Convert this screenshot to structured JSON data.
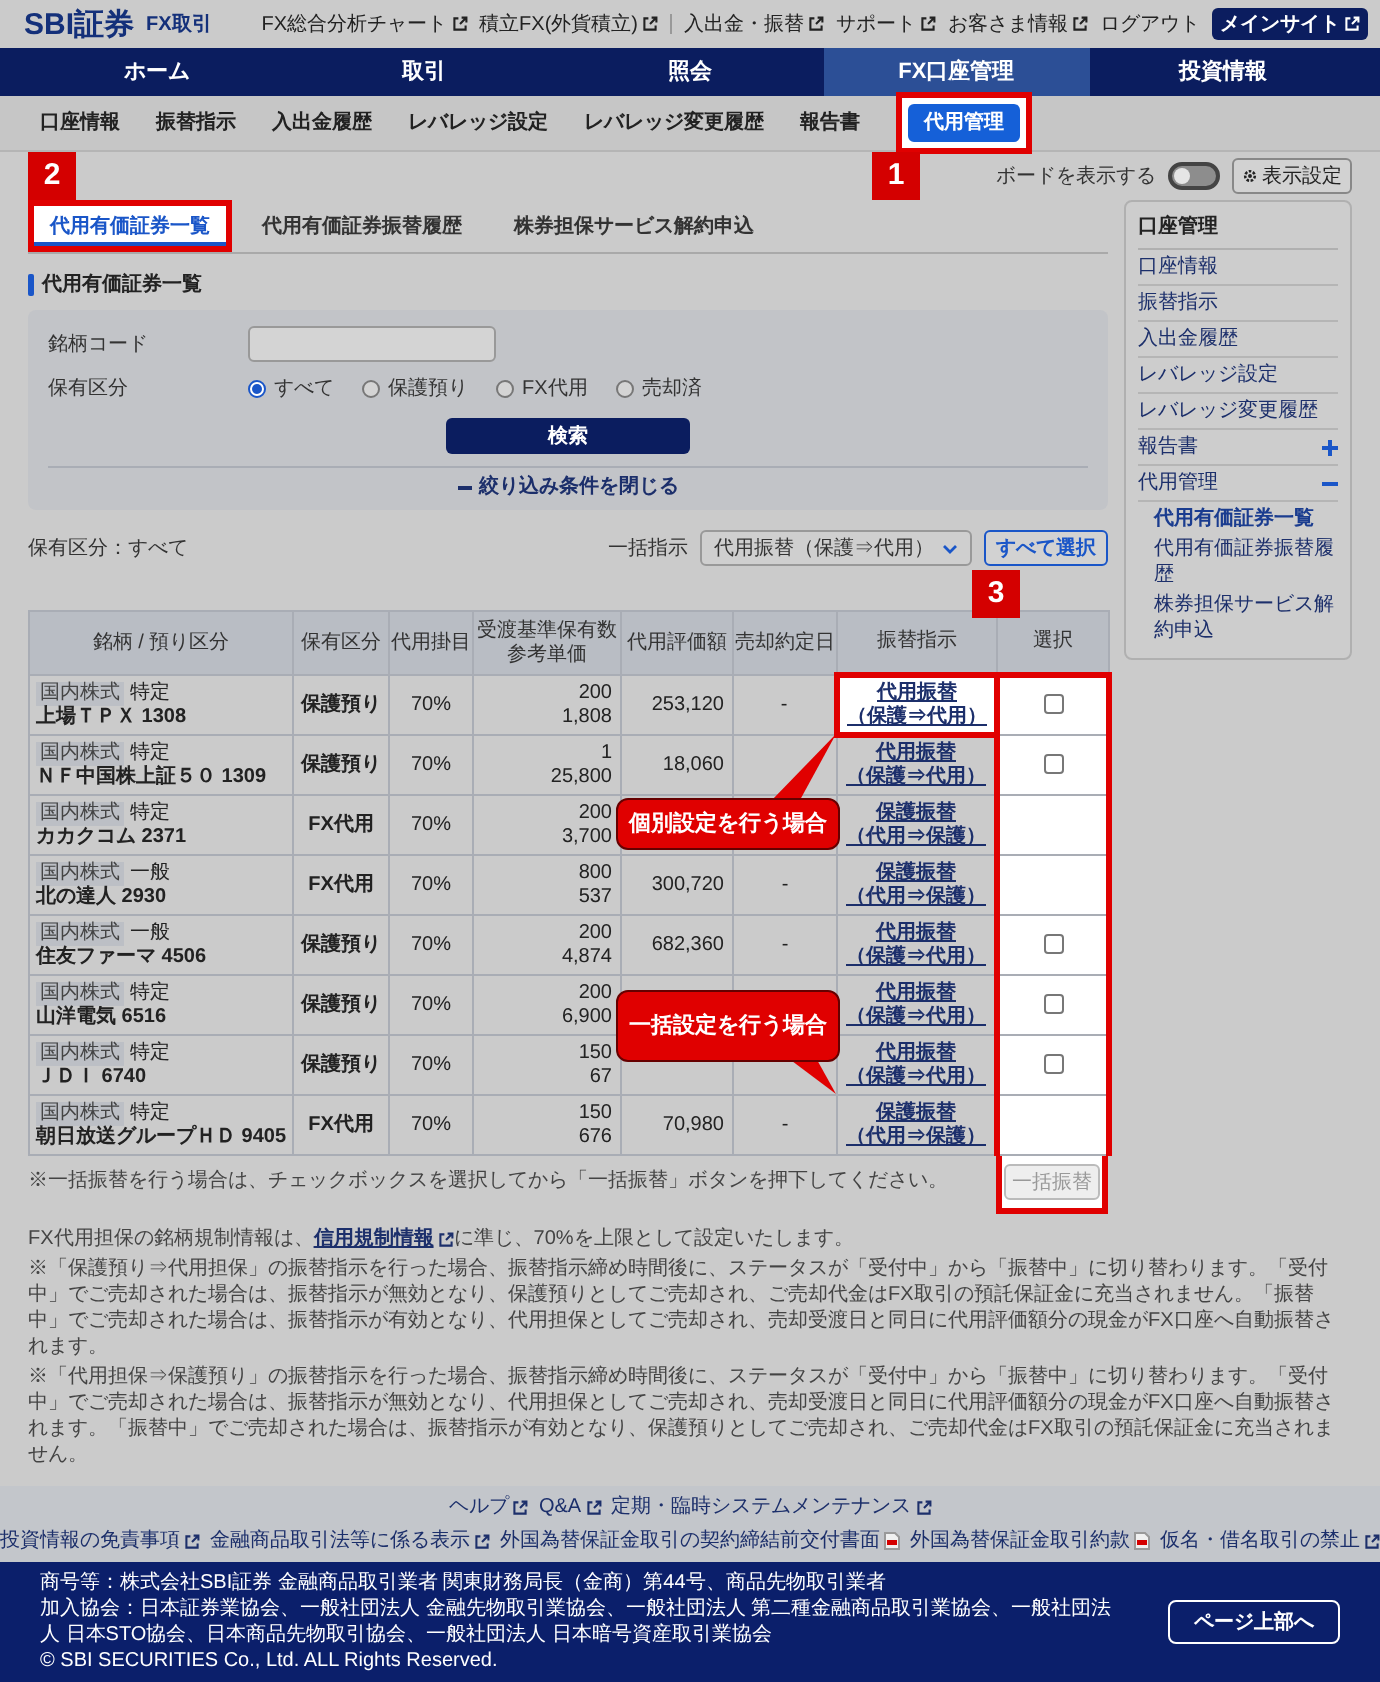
{
  "header": {
    "logo": "SBI証券",
    "product": "FX取引",
    "links": [
      {
        "label": "FX総合分析チャート",
        "kind": "external"
      },
      {
        "label": "積立FX(外貨積立)",
        "kind": "external"
      },
      {
        "label": "入出金・振替",
        "kind": "external"
      },
      {
        "label": "サポート",
        "kind": "external"
      },
      {
        "label": "お客さま情報",
        "kind": "external"
      },
      {
        "label": "ログアウト",
        "kind": "plain"
      }
    ],
    "main_site_button": "メインサイト"
  },
  "nav": [
    {
      "label": "ホーム",
      "selected": false
    },
    {
      "label": "取引",
      "selected": false
    },
    {
      "label": "照会",
      "selected": false
    },
    {
      "label": "FX口座管理",
      "selected": true
    },
    {
      "label": "投資情報",
      "selected": false
    }
  ],
  "subnav": [
    {
      "label": "口座情報",
      "selected": false
    },
    {
      "label": "振替指示",
      "selected": false
    },
    {
      "label": "入出金履歴",
      "selected": false
    },
    {
      "label": "レバレッジ設定",
      "selected": false
    },
    {
      "label": "レバレッジ変更履歴",
      "selected": false
    },
    {
      "label": "報告書",
      "selected": false
    },
    {
      "label": "代用管理",
      "selected": true
    }
  ],
  "board_toggle": {
    "label": "ボードを表示する",
    "on": false
  },
  "display_settings_button": "表示設定",
  "tabs": [
    {
      "label": "代用有価証券一覧",
      "selected": true
    },
    {
      "label": "代用有価証券振替履歴",
      "selected": false
    },
    {
      "label": "株券担保サービス解約申込",
      "selected": false
    }
  ],
  "section_title": "代用有価証券一覧",
  "filter": {
    "code_label": "銘柄コード",
    "holding_label": "保有区分",
    "options": [
      {
        "label": "すべて",
        "selected": true
      },
      {
        "label": "保護預り",
        "selected": false
      },
      {
        "label": "FX代用",
        "selected": false
      },
      {
        "label": "売却済",
        "selected": false
      }
    ],
    "search_button": "検索",
    "collapse_link": "絞り込み条件を閉じる"
  },
  "results": {
    "summary": "保有区分：すべて",
    "bulk_label": "一括指示",
    "bulk_select": "代用振替（保護⇒代用）",
    "select_all_button": "すべて選択",
    "columns": [
      {
        "label": "銘柄 / 預り区分"
      },
      {
        "label": "保有区分"
      },
      {
        "label": "代用掛目"
      },
      {
        "label": "受渡基準保有数",
        "sublabel": "参考単価"
      },
      {
        "label": "代用評価額"
      },
      {
        "label": "売却約定日"
      },
      {
        "label": "振替指示"
      },
      {
        "label": "選択"
      }
    ],
    "rows": [
      {
        "category": "国内株式",
        "account": "特定",
        "name": "上場ＴＰＸ 1308",
        "holding": "保護預り",
        "ratio": "70%",
        "quantity": "200",
        "unit_price": "1,808",
        "valuation": "253,120",
        "sale_date": "-",
        "action": {
          "label": "代用振替",
          "direction": "（保護⇒代用）",
          "highlighted": true
        },
        "selectable": true,
        "checked": false
      },
      {
        "category": "国内株式",
        "account": "特定",
        "name": "ＮＦ中国株上証５０ 1309",
        "holding": "保護預り",
        "ratio": "70%",
        "quantity": "1",
        "unit_price": "25,800",
        "valuation": "18,060",
        "action": {
          "label": "代用振替",
          "direction": "（保護⇒代用）",
          "highlighted": false
        },
        "selectable": true,
        "checked": false
      },
      {
        "category": "国内株式",
        "account": "特定",
        "name": "カカクコム 2371",
        "holding": "FX代用",
        "ratio": "70%",
        "quantity": "200",
        "unit_price": "3,700",
        "action": {
          "label": "保護振替",
          "direction": "（代用⇒保護）",
          "highlighted": false
        },
        "selectable": false
      },
      {
        "category": "国内株式",
        "account": "一般",
        "name": "北の達人 2930",
        "holding": "FX代用",
        "ratio": "70%",
        "quantity": "800",
        "unit_price": "537",
        "valuation": "300,720",
        "sale_date": "-",
        "action": {
          "label": "保護振替",
          "direction": "（代用⇒保護）",
          "highlighted": false
        },
        "selectable": false
      },
      {
        "category": "国内株式",
        "account": "一般",
        "name": "住友ファーマ 4506",
        "holding": "保護預り",
        "ratio": "70%",
        "quantity": "200",
        "unit_price": "4,874",
        "valuation": "682,360",
        "sale_date": "-",
        "action": {
          "label": "代用振替",
          "direction": "（保護⇒代用）",
          "highlighted": false
        },
        "selectable": true,
        "checked": false
      },
      {
        "category": "国内株式",
        "account": "特定",
        "name": "山洋電気 6516",
        "holding": "保護預り",
        "ratio": "70%",
        "quantity": "200",
        "unit_price": "6,900",
        "action": {
          "label": "代用振替",
          "direction": "（保護⇒代用）",
          "highlighted": false
        },
        "selectable": true,
        "checked": false
      },
      {
        "category": "国内株式",
        "account": "特定",
        "name": "ＪＤＩ 6740",
        "holding": "保護預り",
        "ratio": "70%",
        "quantity": "150",
        "unit_price": "67",
        "action": {
          "label": "代用振替",
          "direction": "（保護⇒代用）",
          "highlighted": false
        },
        "selectable": true,
        "checked": false
      },
      {
        "category": "国内株式",
        "account": "特定",
        "name": "朝日放送グループＨＤ 9405",
        "holding": "FX代用",
        "ratio": "70%",
        "quantity": "150",
        "unit_price": "676",
        "valuation": "70,980",
        "sale_date": "-",
        "action": {
          "label": "保護振替",
          "direction": "（代用⇒保護）",
          "highlighted": false
        },
        "selectable": false
      }
    ],
    "bulk_note": "※一括振替を行う場合は、チェックボックスを選択してから「一括振替」ボタンを押下してください。",
    "bulk_button": {
      "label": "一括振替",
      "disabled": true
    }
  },
  "notes": {
    "intro": {
      "before": "FX代用担保の銘柄規制情報は、",
      "link": "信用規制情報",
      "after": "に準じ、70%を上限として設定いたします。"
    },
    "paragraphs": [
      "※「保護預り⇒代用担保」の振替指示を行った場合、振替指示締め時間後に、ステータスが「受付中」から「振替中」に切り替わります。「受付中」でご売却された場合は、振替指示が無効となり、保護預りとしてご売却され、ご売却代金はFX取引の預託保証金に充当されません。「振替中」でご売却された場合は、振替指示が有効となり、代用担保としてご売却され、売却受渡日と同日に代用評価額分の現金がFX口座へ自動振替されます。",
      "※「代用担保⇒保護預り」の振替指示を行った場合、振替指示締め時間後に、ステータスが「受付中」から「振替中」に切り替わります。「受付中」でご売却された場合は、振替指示が無効となり、代用担保としてご売却され、売却受渡日と同日に代用評価額分の現金がFX口座へ自動振替されます。「振替中」でご売却された場合は、振替指示が有効となり、保護預りとしてご売却され、ご売却代金はFX取引の預託保証金に充当されません。"
    ]
  },
  "sidebar": {
    "title": "口座管理",
    "items": [
      {
        "label": "口座情報"
      },
      {
        "label": "振替指示"
      },
      {
        "label": "入出金履歴"
      },
      {
        "label": "レバレッジ設定"
      },
      {
        "label": "レバレッジ変更履歴"
      },
      {
        "label": "報告書",
        "expanded": false
      },
      {
        "label": "代用管理",
        "expanded": true,
        "children": [
          {
            "label": "代用有価証券一覧",
            "selected": true
          },
          {
            "label": "代用有価証券振替履歴",
            "selected": false
          },
          {
            "label": "株券担保サービス解約申込",
            "selected": false
          }
        ]
      }
    ]
  },
  "footer_links": [
    {
      "links": [
        {
          "label": "ヘルプ",
          "kind": "external"
        },
        {
          "label": "Q&A",
          "kind": "external"
        },
        {
          "label": "定期・臨時システムメンテナンス",
          "kind": "external"
        }
      ]
    },
    {
      "links": [
        {
          "label": "投資情報の免責事項",
          "kind": "external"
        },
        {
          "label": "金融商品取引法等に係る表示",
          "kind": "external"
        },
        {
          "label": "外国為替保証金取引の契約締結前交付書面",
          "kind": "pdf"
        },
        {
          "label": "外国為替保証金取引約款",
          "kind": "pdf"
        },
        {
          "label": "仮名・借名取引の禁止",
          "kind": "external"
        }
      ]
    }
  ],
  "footer": {
    "lines": [
      "商号等：株式会社SBI証券 金融商品取引業者 関東財務局長（金商）第44号、商品先物取引業者",
      "加入協会：日本証券業協会、一般社団法人 金融先物取引業協会、一般社団法人 第二種金融商品取引業協会、一般社団法人 日本STO協会、日本商品先物取引協会、一般社団法人 日本暗号資産取引業協会",
      "© SBI SECURITIES Co., Ltd. ALL Rights Reserved."
    ],
    "page_top_button": "ページ上部へ"
  },
  "annotations": {
    "markers": [
      {
        "label": "1"
      },
      {
        "label": "2"
      },
      {
        "label": "3"
      }
    ],
    "callouts": [
      {
        "text": "個別設定を行う場合"
      },
      {
        "text": "一括設定を行う場合"
      }
    ]
  }
}
